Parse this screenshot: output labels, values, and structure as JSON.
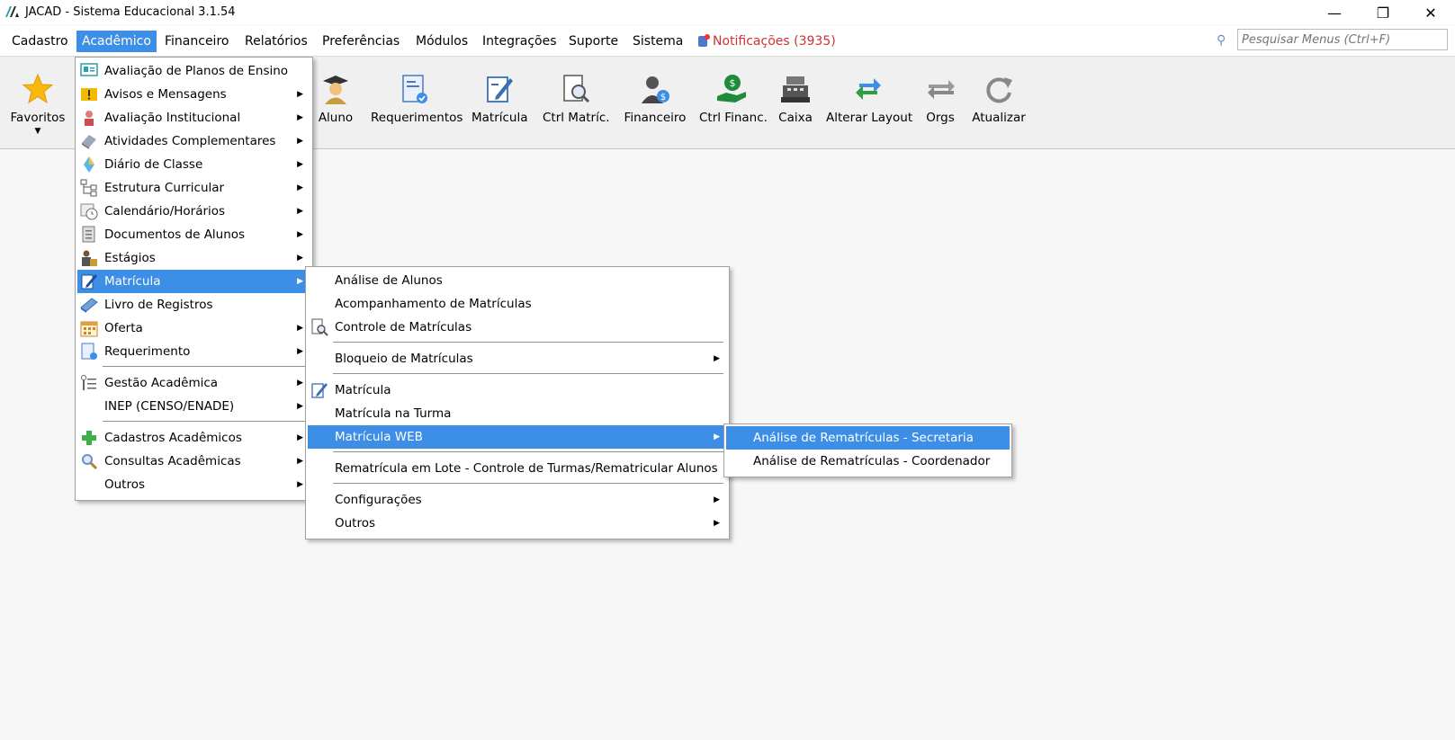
{
  "window": {
    "title": "JACAD - Sistema Educacional 3.1.54",
    "minimize_glyph": "—",
    "maximize_glyph": "❐",
    "close_glyph": "✕"
  },
  "menubar": {
    "items": [
      {
        "label": "Cadastro"
      },
      {
        "label": "Acadêmico",
        "active": true
      },
      {
        "label": "Financeiro"
      },
      {
        "label": "Relatórios"
      },
      {
        "label": "Preferências"
      },
      {
        "label": "Módulos"
      },
      {
        "label": "Integrações"
      },
      {
        "label": "Suporte"
      },
      {
        "label": "Sistema"
      }
    ],
    "notifications": "Notificações (3935)",
    "search_placeholder": "Pesquisar Menus (Ctrl+F)"
  },
  "toolbar": {
    "favorites": "Favoritos",
    "items": [
      {
        "label": "Aluno",
        "icon": "student-icon"
      },
      {
        "label": "Requerimentos",
        "icon": "document-check-icon"
      },
      {
        "label": "Matrícula",
        "icon": "enrollment-edit-icon"
      },
      {
        "label": "Ctrl Matríc.",
        "icon": "document-search-icon"
      },
      {
        "label": "Financeiro",
        "icon": "person-money-icon"
      },
      {
        "label": "Ctrl Financ.",
        "icon": "money-hand-icon"
      },
      {
        "label": "Caixa",
        "icon": "cash-register-icon"
      },
      {
        "label": "Alterar Layout",
        "icon": "swap-arrows-icon"
      },
      {
        "label": "Orgs",
        "icon": "exchange-icon"
      },
      {
        "label": "Atualizar",
        "icon": "refresh-icon"
      }
    ]
  },
  "menu_academico": {
    "items": [
      {
        "label": "Avaliação de Planos de Ensino",
        "submenu": false,
        "icon": "presentation-icon"
      },
      {
        "label": "Avisos e Mensagens",
        "submenu": true,
        "icon": "warning-message-icon"
      },
      {
        "label": "Avaliação Institucional",
        "submenu": true,
        "icon": "person-evaluation-icon"
      },
      {
        "label": "Atividades Complementares",
        "submenu": true,
        "icon": "activities-icon"
      },
      {
        "label": "Diário de Classe",
        "submenu": true,
        "icon": "diary-icon"
      },
      {
        "label": "Estrutura Curricular",
        "submenu": true,
        "icon": "structure-tree-icon"
      },
      {
        "label": "Calendário/Horários",
        "submenu": true,
        "icon": "calendar-clock-icon"
      },
      {
        "label": "Documentos de Alunos",
        "submenu": true,
        "icon": "documents-icon"
      },
      {
        "label": "Estágios",
        "submenu": true,
        "icon": "internship-icon"
      },
      {
        "label": "Matrícula",
        "submenu": true,
        "icon": "enrollment-icon",
        "highlighted": true
      },
      {
        "label": "Livro de Registros",
        "submenu": false,
        "icon": "book-icon"
      },
      {
        "label": "Oferta",
        "submenu": true,
        "icon": "calendar-grid-icon"
      },
      {
        "label": "Requerimento",
        "submenu": true,
        "icon": "request-icon"
      },
      {
        "label": "Gestão Acadêmica",
        "submenu": true,
        "icon": "management-icon"
      },
      {
        "label": "INEP (CENSO/ENADE)",
        "submenu": true,
        "icon": ""
      },
      {
        "label": "Cadastros Acadêmicos",
        "submenu": true,
        "icon": "plus-icon"
      },
      {
        "label": "Consultas Acadêmicas",
        "submenu": true,
        "icon": "magnifier-icon"
      },
      {
        "label": "Outros",
        "submenu": true,
        "icon": ""
      }
    ]
  },
  "menu_matricula": {
    "items": [
      {
        "label": "Análise de Alunos",
        "submenu": false,
        "icon": ""
      },
      {
        "label": "Acompanhamento de Matrículas",
        "submenu": false,
        "icon": ""
      },
      {
        "label": "Controle de Matrículas",
        "submenu": false,
        "icon": "document-search-icon"
      },
      {
        "label": "Bloqueio de Matrículas",
        "submenu": true,
        "icon": ""
      },
      {
        "label": "Matrícula",
        "submenu": false,
        "icon": "enrollment-edit-icon"
      },
      {
        "label": "Matrícula na Turma",
        "submenu": false,
        "icon": ""
      },
      {
        "label": "Matrícula WEB",
        "submenu": true,
        "icon": "",
        "highlighted": true
      },
      {
        "label": "Rematrícula em Lote - Controle de Turmas/Rematricular Alunos",
        "submenu": false,
        "icon": ""
      },
      {
        "label": "Configurações",
        "submenu": true,
        "icon": ""
      },
      {
        "label": "Outros",
        "submenu": true,
        "icon": ""
      }
    ]
  },
  "menu_matricula_web": {
    "items": [
      {
        "label": "Análise de Rematrículas - Secretaria",
        "highlighted": true
      },
      {
        "label": "Análise de Rematrículas - Coordenador"
      }
    ]
  },
  "colors": {
    "highlight": "#3d8ee6",
    "notification": "#cc3333"
  }
}
